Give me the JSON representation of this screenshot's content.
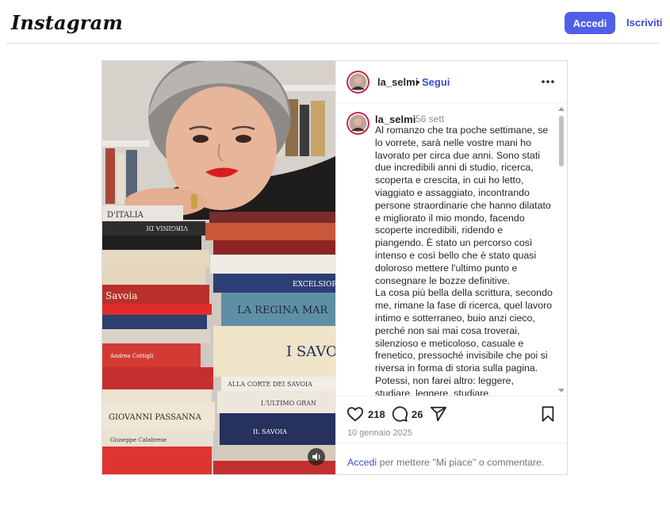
{
  "header": {
    "logo_text": "Instagram",
    "login_label": "Accedi",
    "signup_label": "Iscriviti",
    "accent_color": "#4f5fe8"
  },
  "post": {
    "username": "la_selmi",
    "separator": "•",
    "follow_label": "Segui",
    "more_icon": "more-horizontal-icon",
    "caption_username": "la_selmi",
    "caption_time": "56 sett",
    "caption_paragraphs": [
      "Al romanzo che tra poche settimane, se lo vorrete, sarà nelle vostre mani ho lavorato per circa due anni. Sono stati due incredibili anni di studio, ricerca, scoperta e crescita, in cui ho letto, viaggiato e assaggiato, incontrando persone straordinarie che hanno dilatato e migliorato il mio mondo, facendo scoperte incredibili, ridendo e piangendo. È stato un percorso così intenso e così bello che è stato quasi doloroso mettere l'ultimo punto e consegnare le bozze definitive.",
      "La cosa più bella della scrittura, secondo me, rimane la fase di ricerca, quel lavoro intimo e sotterraneo, buio anzi cieco, perché non sai mai cosa troverai, silenzioso e meticoloso, casuale e frenetico, pressoché invisibile che poi si riversa in forma di storia sulla pagina. Potessi, non farei altro: leggere, studiare, leggere, studiare."
    ],
    "likes": "218",
    "comments": "26",
    "date": "10 gennaio 2025",
    "login_prompt_link": "Accedi",
    "login_prompt_rest": " per mettere \"Mi piace\" o commentare.",
    "book_spines": [
      "D'ITALIA",
      "VIRGINIA DI",
      "Savoia",
      "LA REGINA MAR",
      "I SAVOI",
      "EXCELSIOR",
      "GIOVANNI PASSANNA",
      "ALLA CORTE DEI SAVOIA",
      "Giuseppe Calabrese",
      "IL SAVOIA",
      "Andrea Cottigli",
      "L'ULTIMO GRAN"
    ]
  }
}
